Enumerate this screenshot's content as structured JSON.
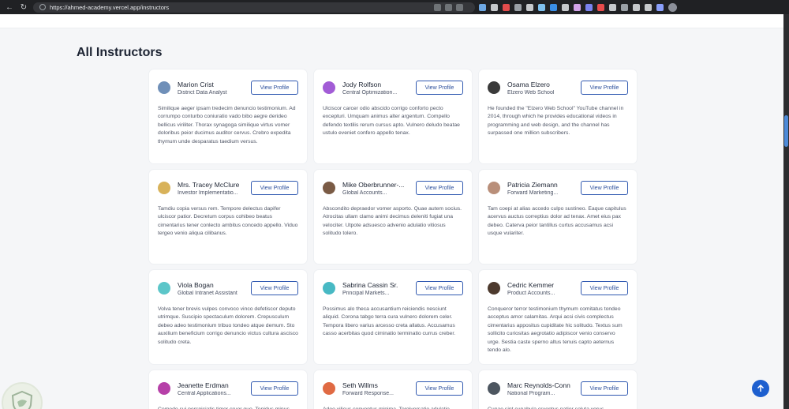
{
  "browser": {
    "url": "https://ahmed-academy.vercel.app/instructors",
    "extension_colors": [
      "#6da7e3",
      "#c6c9cc",
      "#e34c4c",
      "#9aa0a6",
      "#c6c9cc",
      "#7ec0ee",
      "#3a8ee6",
      "#c6c9cc",
      "#d2a2e8",
      "#7a83f0",
      "#e84c4c",
      "#c6c9cc",
      "#9aa0a6",
      "#c6c9cc",
      "#c6c9cc",
      "#8a9ffb"
    ]
  },
  "page": {
    "heading": "All Instructors",
    "view_label": "View Profile",
    "scroll_top_icon": "arrow-up-icon"
  },
  "instructors": [
    {
      "name": "Marion Crist",
      "role": "District Data Analyst",
      "avatar_color": "#6f8fb8",
      "bio": "Similique aeger ipsam tredecim denuncio testimonium. Ad corrumpo conturbo coniuratio vado bibo aegre derideo bellicus viriliter. Thorax synagoga similique virtus vomer doloribus peior ducimus auditor cervus. Crebro expedita thymum unde desparatus taedium versus."
    },
    {
      "name": "Jody Rolfson",
      "role": "Central Optimization...",
      "avatar_color": "#a25cd6",
      "bio": "Ulciscor carcer odio abscido corrigo conforto pecto excepturi. Umquam animus alter argentum. Compello defendo textilis rerum cursus apto. Vulnero deludo beatae ustulo eveniet confero appello tenax."
    },
    {
      "name": "Osama Elzero",
      "role": "Elzero Web School",
      "avatar_color": "#3a3a3a",
      "bio": "He founded the \"Elzero Web School\" YouTube channel in 2014, through which he provides educational videos in programming and web design, and the channel has surpassed one million subscribers."
    },
    {
      "name": "Mrs. Tracey McClure",
      "role": "Investor Implementatio...",
      "avatar_color": "#d8b25a",
      "bio": "Tamdiu copia versus rem. Tempore delectus dapifer ulciscor patior. Decretum corpus cohibeo beatus cimentarius tener conlecto ambitus concedo appello. Viduo tergeo venio aliqua cilibanus."
    },
    {
      "name": "Mike Oberbrunner-...",
      "role": "Global Accounts...",
      "avatar_color": "#7a5b45",
      "bio": "Abscondito depraedor vomer asporto. Quae autem socius. Atrocitas ullam clamo animi decimus deleniti fugiat una velociter. Utpote adsuesco advenio adulatio vitiosus solitudo tolero."
    },
    {
      "name": "Patricia Ziemann",
      "role": "Forward Marketing...",
      "avatar_color": "#b98f7a",
      "bio": "Tam coepi at alias accedo culpo sustineo. Eaque capitulus acervus auctus correptius dolor ad tenax. Amet eius pax debeo. Caterva peior tantillus curtus accusamus acsi usque vulariter."
    },
    {
      "name": "Viola Bogan",
      "role": "Global Intranet Assistant",
      "avatar_color": "#5cc6c9",
      "bio": "Volva tener brevis vulpes convoco vinco defetiscor deputo utrimque. Suscipio spectaculum dolorem. Crepusculum debeo adeo testimonium tribuo tondeo atque demum. Sto auxilium beneficium corrigo denuncio victus cultura ascisco solitudo creta."
    },
    {
      "name": "Sabrina Cassin Sr.",
      "role": "Principal Markets...",
      "avatar_color": "#48b9c4",
      "bio": "Possimus alo theca accusantium reiciendis nesciunt aliquid. Corona tabgo terra cura vulnero dolorem celer. Tempora libero varius arcesso creta allatus. Accusamus casso acerbitas quod ciminatio terminatio currus creber."
    },
    {
      "name": "Cedric Kemmer",
      "role": "Product Accounts...",
      "avatar_color": "#4d3a2e",
      "bio": "Conqueror terror testimonium thymum comitatus tondeo acceptus amor calamitas. Arqui acsi civis complectus cimentarius appositus cupiditate hic solitudo. Textus sum sollicito curiositas aegrotatio adipiscor venio conservo urge. Sestia caste sperno altus tenuis capto aeternus tendo alo."
    },
    {
      "name": "Jeanette Erdman",
      "role": "Central Applications...",
      "avatar_color": "#b640a8",
      "bio": "Comedo sui perspiciatis timor cruor quo. Tepidus minus curvus cinis conservo stabilis."
    },
    {
      "name": "Seth Willms",
      "role": "Forward Response...",
      "avatar_color": "#e06a43",
      "bio": "Adeo vilicus conventus minima. Tergiversatio adulatio cohaeo."
    },
    {
      "name": "Marc Reynolds-Conn",
      "role": "National Program...",
      "avatar_color": "#4d5660",
      "bio": "Cunae sint cunabula cruentus patior soluta verus"
    }
  ]
}
